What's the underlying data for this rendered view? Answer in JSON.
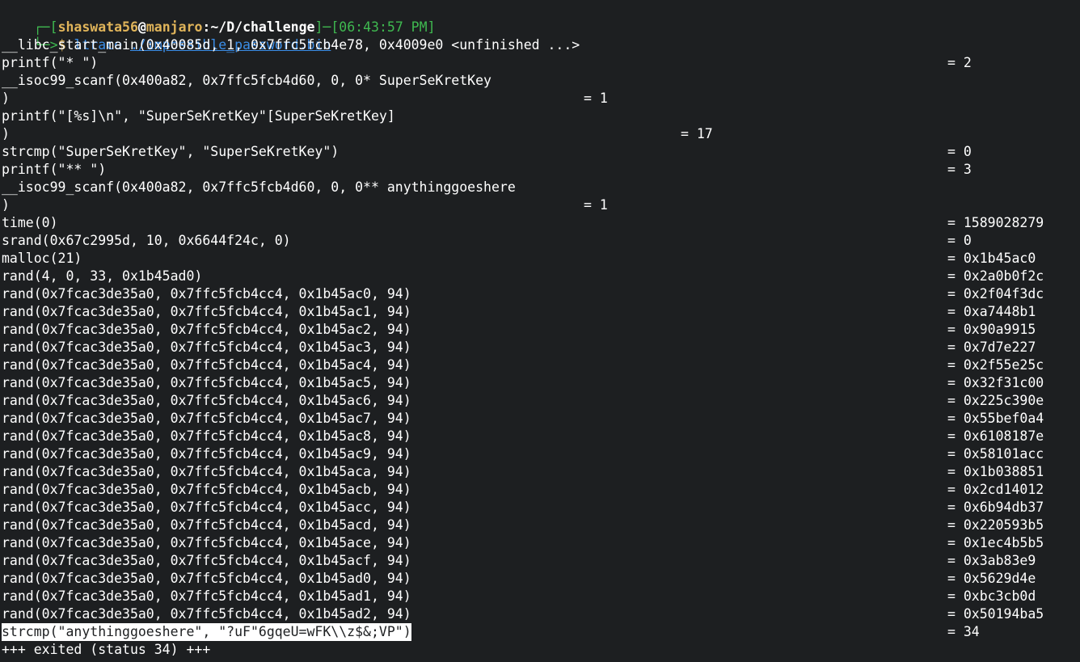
{
  "prompt": {
    "corner_top": "┌─[",
    "user": "shaswata56",
    "at": "@",
    "host": "manjaro",
    "colon": ":",
    "path": "~/D/challenge",
    "dash_bracket": "]─[",
    "time": "06:43:57 PM",
    "close": "]",
    "corner_bottom": "└─>",
    "dollar": "$ ",
    "command": "ltrace",
    "argument": "./impossible_password.bin"
  },
  "trace": [
    {
      "call": "__libc_start_main(0x40085d, 1, 0x7ffc5fcb4e78, 0x4009e0 <unfinished ...>",
      "ret": ""
    },
    {
      "call": "printf(\"* \")",
      "ret": "= 2"
    },
    {
      "call": "__isoc99_scanf(0x400a82, 0x7ffc5fcb4d60, 0, 0* SuperSeKretKey",
      "ret": ""
    },
    {
      "call": ")",
      "ret": "= 1",
      "col": "mid"
    },
    {
      "call": "printf(\"[%s]\\n\", \"SuperSeKretKey\"[SuperSeKretKey]",
      "ret": ""
    },
    {
      "call": ")",
      "ret": "= 17",
      "col": "mid2"
    },
    {
      "call": "strcmp(\"SuperSeKretKey\", \"SuperSeKretKey\")",
      "ret": "= 0"
    },
    {
      "call": "printf(\"** \")",
      "ret": "= 3"
    },
    {
      "call": "__isoc99_scanf(0x400a82, 0x7ffc5fcb4d60, 0, 0** anythinggoeshere",
      "ret": ""
    },
    {
      "call": ")",
      "ret": "= 1",
      "col": "mid"
    },
    {
      "call": "time(0)",
      "ret": "= 1589028279"
    },
    {
      "call": "srand(0x67c2995d, 10, 0x6644f24c, 0)",
      "ret": "= 0"
    },
    {
      "call": "malloc(21)",
      "ret": "= 0x1b45ac0"
    },
    {
      "call": "rand(4, 0, 33, 0x1b45ad0)",
      "ret": "= 0x2a0b0f2c"
    },
    {
      "call": "rand(0x7fcac3de35a0, 0x7ffc5fcb4cc4, 0x1b45ac0, 94)",
      "ret": "= 0x2f04f3dc"
    },
    {
      "call": "rand(0x7fcac3de35a0, 0x7ffc5fcb4cc4, 0x1b45ac1, 94)",
      "ret": "= 0xa7448b1"
    },
    {
      "call": "rand(0x7fcac3de35a0, 0x7ffc5fcb4cc4, 0x1b45ac2, 94)",
      "ret": "= 0x90a9915"
    },
    {
      "call": "rand(0x7fcac3de35a0, 0x7ffc5fcb4cc4, 0x1b45ac3, 94)",
      "ret": "= 0x7d7e227"
    },
    {
      "call": "rand(0x7fcac3de35a0, 0x7ffc5fcb4cc4, 0x1b45ac4, 94)",
      "ret": "= 0x2f55e25c"
    },
    {
      "call": "rand(0x7fcac3de35a0, 0x7ffc5fcb4cc4, 0x1b45ac5, 94)",
      "ret": "= 0x32f31c00"
    },
    {
      "call": "rand(0x7fcac3de35a0, 0x7ffc5fcb4cc4, 0x1b45ac6, 94)",
      "ret": "= 0x225c390e"
    },
    {
      "call": "rand(0x7fcac3de35a0, 0x7ffc5fcb4cc4, 0x1b45ac7, 94)",
      "ret": "= 0x55bef0a4"
    },
    {
      "call": "rand(0x7fcac3de35a0, 0x7ffc5fcb4cc4, 0x1b45ac8, 94)",
      "ret": "= 0x6108187e"
    },
    {
      "call": "rand(0x7fcac3de35a0, 0x7ffc5fcb4cc4, 0x1b45ac9, 94)",
      "ret": "= 0x58101acc"
    },
    {
      "call": "rand(0x7fcac3de35a0, 0x7ffc5fcb4cc4, 0x1b45aca, 94)",
      "ret": "= 0x1b038851"
    },
    {
      "call": "rand(0x7fcac3de35a0, 0x7ffc5fcb4cc4, 0x1b45acb, 94)",
      "ret": "= 0x2cd14012"
    },
    {
      "call": "rand(0x7fcac3de35a0, 0x7ffc5fcb4cc4, 0x1b45acc, 94)",
      "ret": "= 0x6b94db37"
    },
    {
      "call": "rand(0x7fcac3de35a0, 0x7ffc5fcb4cc4, 0x1b45acd, 94)",
      "ret": "= 0x220593b5"
    },
    {
      "call": "rand(0x7fcac3de35a0, 0x7ffc5fcb4cc4, 0x1b45ace, 94)",
      "ret": "= 0x1ec4b5b5"
    },
    {
      "call": "rand(0x7fcac3de35a0, 0x7ffc5fcb4cc4, 0x1b45acf, 94)",
      "ret": "= 0x3ab83e9"
    },
    {
      "call": "rand(0x7fcac3de35a0, 0x7ffc5fcb4cc4, 0x1b45ad0, 94)",
      "ret": "= 0x5629d4e"
    },
    {
      "call": "rand(0x7fcac3de35a0, 0x7ffc5fcb4cc4, 0x1b45ad1, 94)",
      "ret": "= 0xbc3cb0d"
    },
    {
      "call": "rand(0x7fcac3de35a0, 0x7ffc5fcb4cc4, 0x1b45ad2, 94)",
      "ret": "= 0x50194ba5"
    },
    {
      "call": "strcmp(\"anythinggoeshere\", \"?uF\"6gqeU=wFK\\\\z$&;VP\")",
      "ret": "= 34",
      "selected": true
    }
  ],
  "exit_line": "+++ exited (status 34) +++",
  "colors": {
    "background": "#1d1f21",
    "text": "#ffffff",
    "prompt_frame": "#3fb950",
    "prompt_user": "#e0b45a",
    "command": "#3b8ee8",
    "selection_bg": "#ffffff"
  }
}
